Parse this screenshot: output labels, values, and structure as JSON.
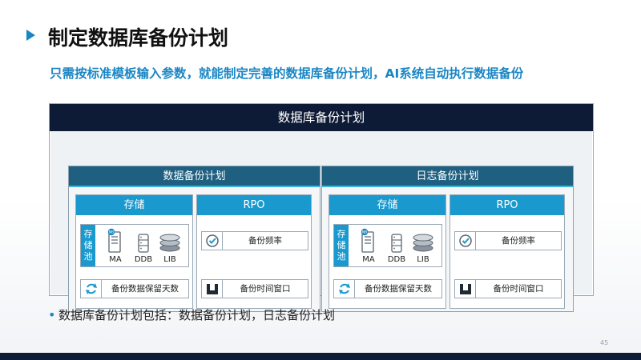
{
  "title": "制定数据库备份计划",
  "subtitle": "只需按标准模板输入参数，就能制定完善的数据库备份计划，AI系统自动执行数据备份",
  "diagram": {
    "header": "数据库备份计划",
    "plans": [
      {
        "label": "数据备份计划",
        "storage": {
          "header": "存储",
          "pool_label": "存储池",
          "devices": [
            {
              "label": "MA",
              "badge": "NB",
              "icon": "server-icon"
            },
            {
              "label": "DDB",
              "icon": "database-icon"
            },
            {
              "label": "LIB",
              "icon": "disk-stack-icon"
            }
          ],
          "retention_label": "备份数据保留天数"
        },
        "rpo": {
          "header": "RPO",
          "frequency_label": "备份频率",
          "window_label": "备份时间窗口"
        }
      },
      {
        "label": "日志备份计划",
        "storage": {
          "header": "存储",
          "pool_label": "存储池",
          "devices": [
            {
              "label": "MA",
              "badge": "NB",
              "icon": "server-icon"
            },
            {
              "label": "DDB",
              "icon": "database-icon"
            },
            {
              "label": "LIB",
              "icon": "disk-stack-icon"
            }
          ],
          "retention_label": "备份数据保留天数"
        },
        "rpo": {
          "header": "RPO",
          "frequency_label": "备份频率",
          "window_label": "备份时间窗口"
        }
      }
    ]
  },
  "bullet": "数据库备份计划包括：数据备份计划，日志备份计划",
  "page_number": "45",
  "colors": {
    "accent": "#1a86c4",
    "navy": "#0e1b36",
    "plan_header": "#1f5f80",
    "panel_header": "#1a99cf"
  }
}
